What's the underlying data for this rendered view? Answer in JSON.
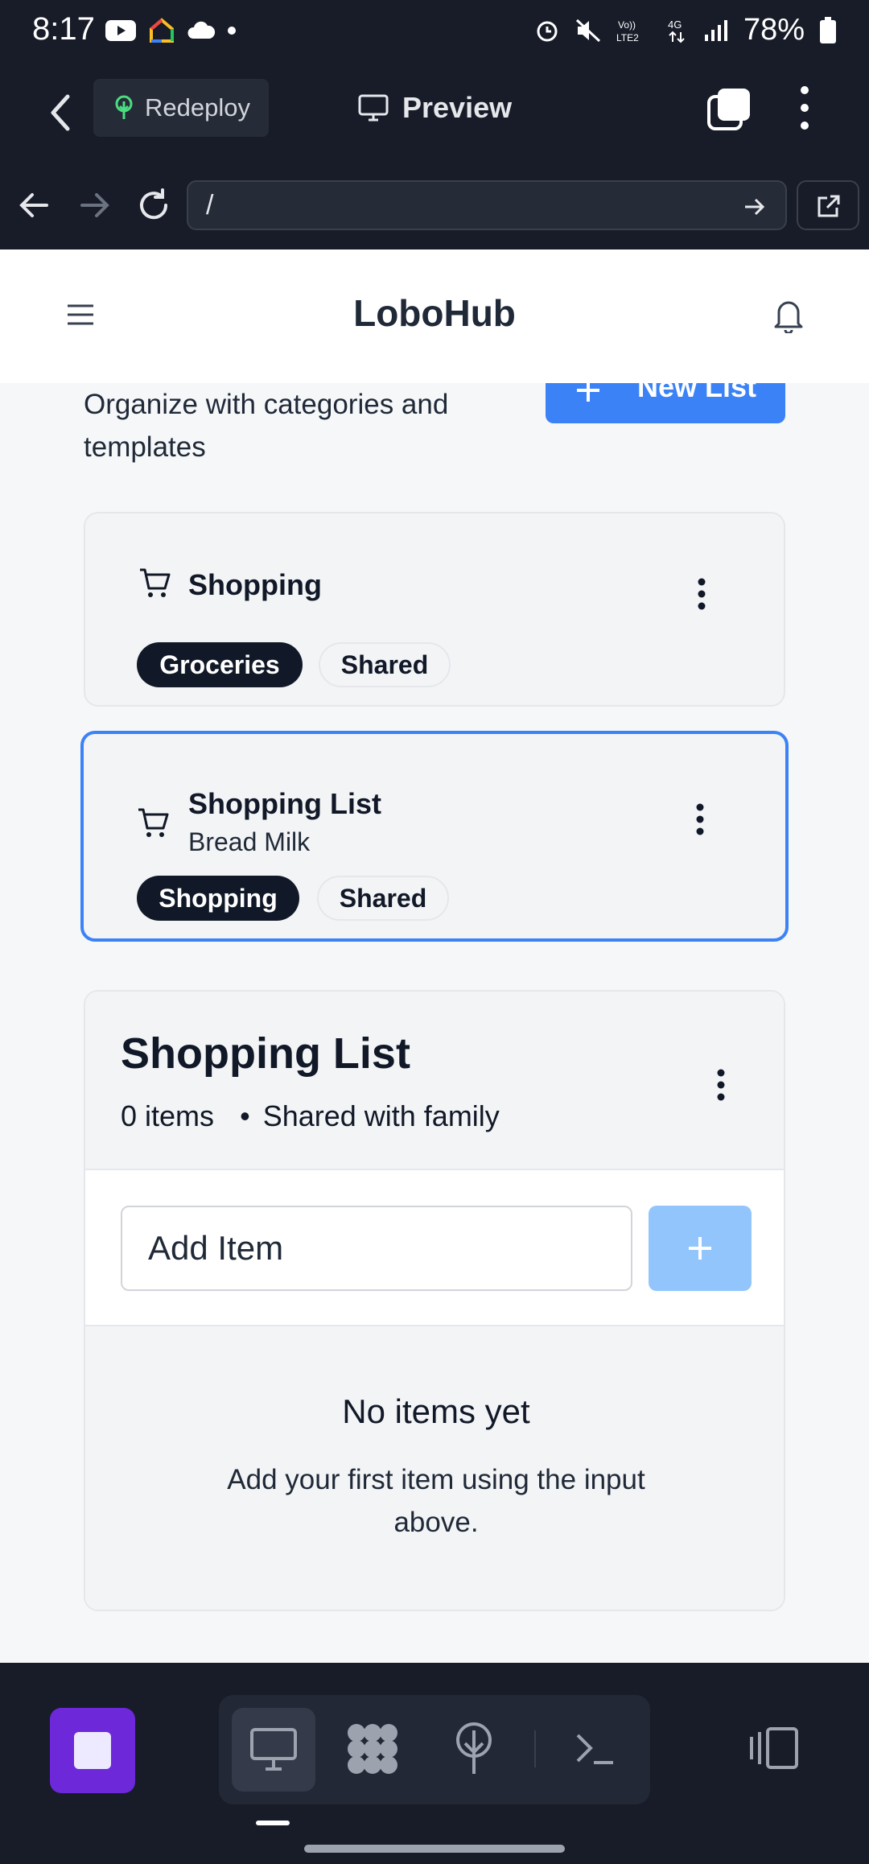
{
  "status_bar": {
    "time": "8:17",
    "battery": "78%"
  },
  "toolbar": {
    "redeploy_label": "Redeploy",
    "preview_label": "Preview"
  },
  "browser": {
    "url": "/"
  },
  "header": {
    "brand": "LoboHub"
  },
  "page": {
    "subtitle": "Organize with categories and templates",
    "new_list_label": "New List"
  },
  "lists": [
    {
      "title": "Shopping",
      "description": "",
      "tags": [
        "Groceries",
        "Shared"
      ]
    },
    {
      "title": "Shopping List",
      "description": "Bread Milk",
      "tags": [
        "Shopping",
        "Shared"
      ]
    }
  ],
  "detail": {
    "title": "Shopping List",
    "item_count": "0 items",
    "sharing": "Shared with family",
    "add_placeholder": "Add Item",
    "empty_title": "No items yet",
    "empty_desc": "Add your first item using the input above."
  },
  "colors": {
    "accent": "#3b82f6",
    "dark_chrome": "#181c28",
    "stop_button": "#6d28d9"
  }
}
